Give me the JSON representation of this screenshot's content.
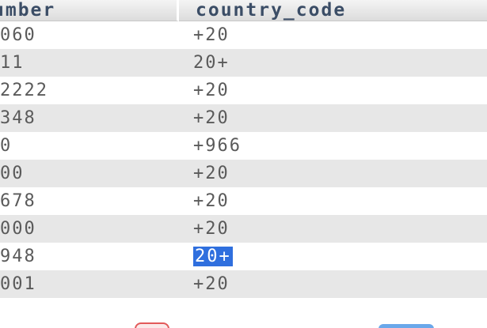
{
  "table": {
    "headers": {
      "number": "umber",
      "country_code": "country_code"
    },
    "rows": [
      {
        "number": "060",
        "country_code": "+20"
      },
      {
        "number": "11",
        "country_code": "20+"
      },
      {
        "number": "2222",
        "country_code": "+20"
      },
      {
        "number": "348",
        "country_code": "+20"
      },
      {
        "number": "0",
        "country_code": "+966"
      },
      {
        "number": "00",
        "country_code": "+20"
      },
      {
        "number": "678",
        "country_code": "+20"
      },
      {
        "number": "000",
        "country_code": "+20"
      },
      {
        "number": "948",
        "country_code": "20+"
      },
      {
        "number": "001",
        "country_code": "+20"
      }
    ],
    "selected_cell": {
      "row": 8,
      "column": "country_code"
    }
  },
  "colors": {
    "header_text": "#3b4d66",
    "stripe": "#e7e7e7",
    "selection": "#2f6fde"
  }
}
